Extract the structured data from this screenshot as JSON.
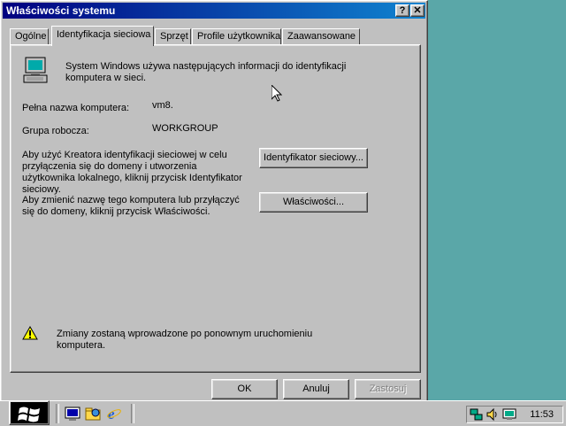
{
  "window": {
    "title": "Właściwości systemu",
    "help_label": "?",
    "close_label": "✕"
  },
  "tabs": [
    {
      "label": "Ogólne"
    },
    {
      "label": "Identyfikacja sieciowa"
    },
    {
      "label": "Sprzęt"
    },
    {
      "label": "Profile użytkownika"
    },
    {
      "label": "Zaawansowane"
    }
  ],
  "panel": {
    "intro": "System Windows używa następujących informacji do identyfikacji komputera w sieci.",
    "full_name_label": "Pełna nazwa komputera:",
    "full_name_value": "vm8.",
    "workgroup_label": "Grupa robocza:",
    "workgroup_value": "WORKGROUP",
    "wizard_text": "Aby użyć Kreatora identyfikacji sieciowej w celu przyłączenia się do domeny i utworzenia użytkownika lokalnego, kliknij przycisk Identyfikator sieciowy.",
    "network_id_button": "Identyfikator sieciowy...",
    "rename_text": "Aby zmienić nazwę tego komputera lub przyłączyć się do domeny, kliknij przycisk Właściwości.",
    "properties_button": "Właściwości...",
    "warning_text": "Zmiany zostaną wprowadzone po ponownym uruchomieniu komputera."
  },
  "buttons": {
    "ok": "OK",
    "cancel": "Anuluj",
    "apply": "Zastosuj"
  },
  "taskbar": {
    "clock": "11:53",
    "quicklaunch_icons": [
      "show-desktop-icon",
      "explorer-icon",
      "internet-explorer-icon"
    ],
    "tray_icons": [
      "network-icon",
      "volume-icon",
      "display-icon"
    ]
  }
}
